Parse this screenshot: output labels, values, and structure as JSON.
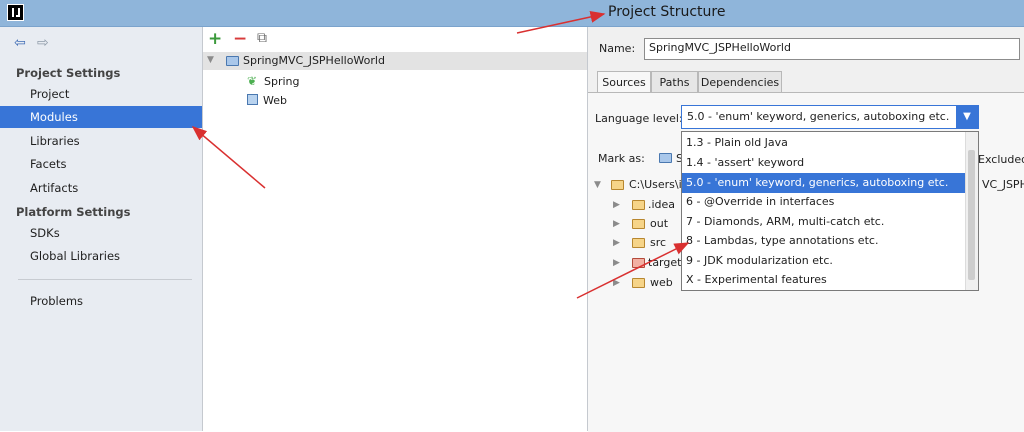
{
  "window": {
    "title": "Project Structure"
  },
  "nav": {
    "back": "⇦",
    "forward": "⇨"
  },
  "sidebar": {
    "project_settings_header": "Project Settings",
    "items": [
      "Project",
      "Modules",
      "Libraries",
      "Facets",
      "Artifacts"
    ],
    "platform_settings_header": "Platform Settings",
    "platform_items": [
      "SDKs",
      "Global Libraries"
    ],
    "problems": "Problems",
    "selected": "Modules"
  },
  "toolbar": {
    "add": "+",
    "remove": "−",
    "copy": "⧉"
  },
  "module_tree": {
    "root": "SpringMVC_JSPHelloWorld",
    "children": [
      "Spring",
      "Web"
    ]
  },
  "module": {
    "name_label": "Name:",
    "name_value": "SpringMVC_JSPHelloWorld",
    "tabs": [
      "Sources",
      "Paths",
      "Dependencies"
    ],
    "active_tab": "Sources",
    "language_level_label": "Language level:",
    "language_level_value": "5.0 - 'enum' keyword, generics, autoboxing etc.",
    "language_level_options": [
      "1.3 - Plain old Java",
      "1.4 - 'assert' keyword",
      "5.0 - 'enum' keyword, generics, autoboxing etc.",
      "6 - @Override in interfaces",
      "7 - Diamonds, ARM, multi-catch etc.",
      "8 - Lambdas, type annotations etc.",
      "9 - JDK modularization etc.",
      "X - Experimental features"
    ],
    "mark_as_label": "Mark as:",
    "mark_as_first_partial": "S",
    "excluded_partial": "Excluded",
    "content_root_partial_left": "C:\\Users\\i",
    "content_root_partial_right": "VC_JSPHe",
    "folders": [
      "idea",
      "out",
      "src",
      "target",
      "web"
    ]
  },
  "colors": {
    "accent": "#3875d7",
    "titlebar": "#8fb5da",
    "annotation_arrow": "#d93030"
  }
}
